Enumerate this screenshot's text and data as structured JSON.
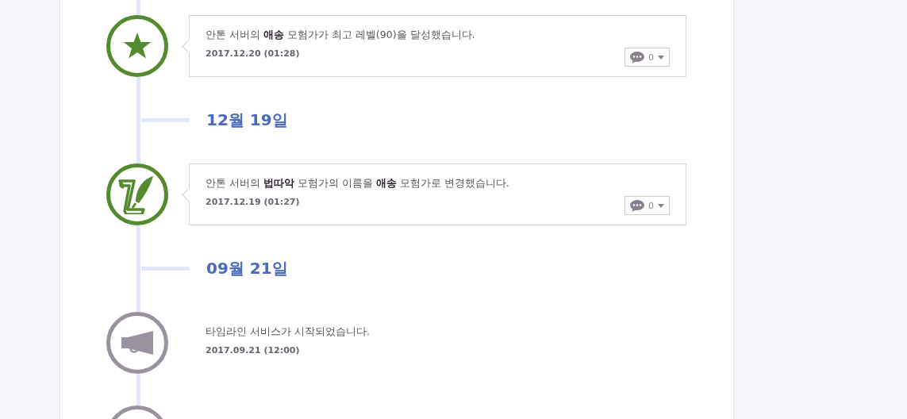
{
  "timeline": [
    {
      "kind": "card_event",
      "node": {
        "kind": "star",
        "color": "#558b2f"
      },
      "text": "안톤 서버의 **애송** 모험가가 최고 레벨(90)을 달성했습니다.",
      "time": "2017.12.20 (01:28)",
      "comments": "0"
    },
    {
      "kind": "date",
      "label": "12월 19일"
    },
    {
      "kind": "card_event",
      "node": {
        "kind": "quill",
        "color": "#558b2f"
      },
      "text": "안톤 서버의 **법따악** 모험가의 이름을 **애송** 모험가로 변경했습니다.",
      "time": "2017.12.19 (01:27)",
      "comments": "0"
    },
    {
      "kind": "date",
      "label": "09월 21일"
    },
    {
      "kind": "plain_event",
      "node": {
        "kind": "megaphone",
        "color": "#9b929f"
      },
      "text": "타임라인 서비스가 시작되었습니다.",
      "time": "2017.09.21 (12:00)"
    },
    {
      "kind": "plain_event",
      "node": {
        "kind": "empty",
        "color": "#9b929f"
      }
    }
  ]
}
